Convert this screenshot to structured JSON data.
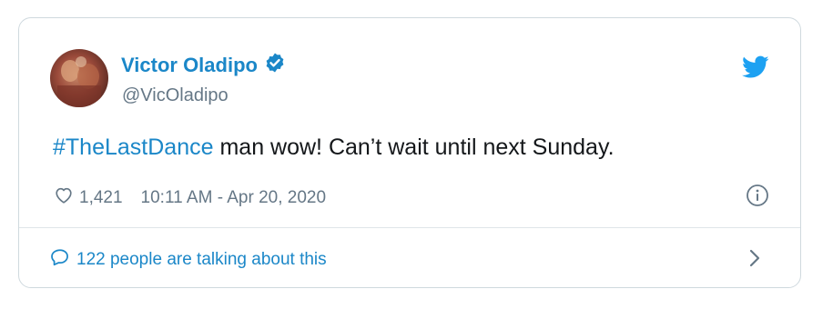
{
  "tweet": {
    "author": {
      "display_name": "Victor Oladipo",
      "handle": "@VicOladipo",
      "verified": true
    },
    "text": {
      "hashtag": "#TheLastDance",
      "body": " man wow! Can’t wait until next Sunday."
    },
    "likes": "1,421",
    "timestamp": "10:11 AM - Apr 20, 2020",
    "conversation": {
      "label": "122 people are talking about this"
    }
  },
  "icons": {
    "brand": "twitter-bird-icon",
    "verified": "verified-badge-icon",
    "like": "heart-icon",
    "info": "info-icon",
    "reply": "speech-bubble-icon",
    "more": "chevron-right-icon"
  },
  "colors": {
    "accent": "#1b87c8",
    "text": "#14171a",
    "muted": "#657786",
    "border": "#cfd9de"
  }
}
